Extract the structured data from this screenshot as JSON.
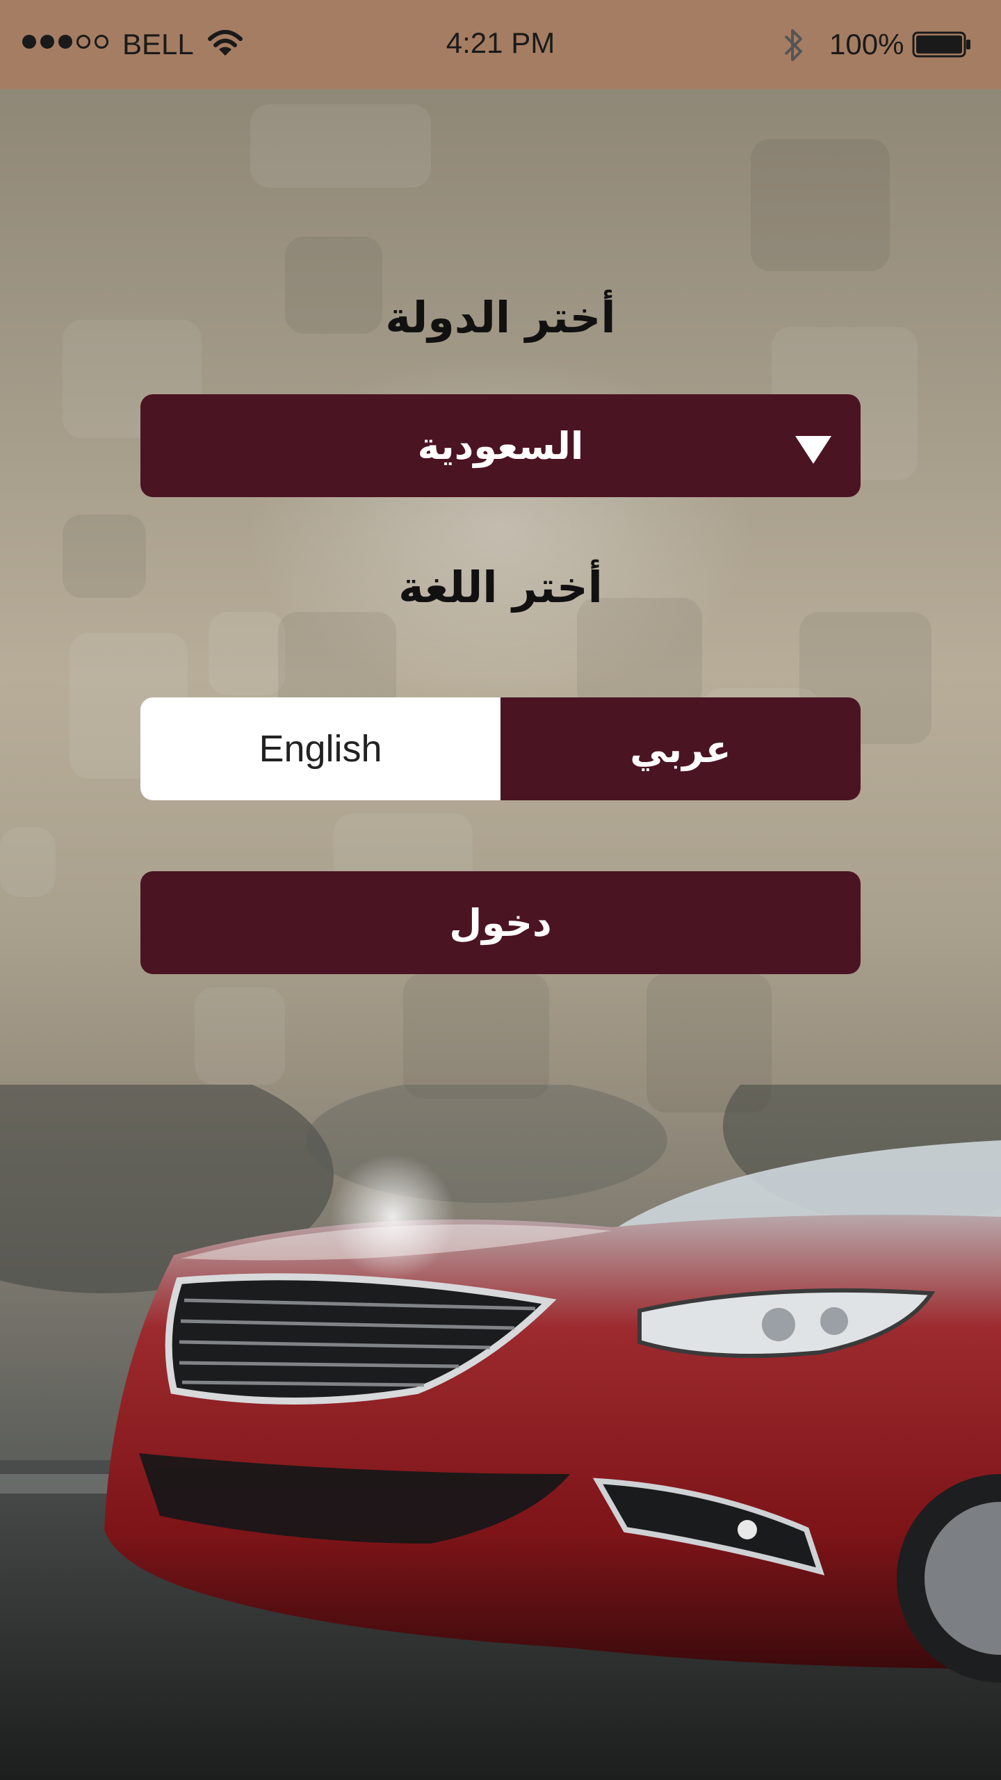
{
  "status_bar": {
    "carrier": "BELL",
    "time": "4:21 PM",
    "battery": "100%"
  },
  "country": {
    "label": "أختر الدولة",
    "selected": "السعودية"
  },
  "language": {
    "label": "أختر اللغة",
    "english": "English",
    "arabic": "عربي",
    "selected": "عربي"
  },
  "login_label": "دخول",
  "colors": {
    "status_bar": "#a57d62",
    "accent": "#4b1423",
    "car": "#8e1b1e"
  }
}
